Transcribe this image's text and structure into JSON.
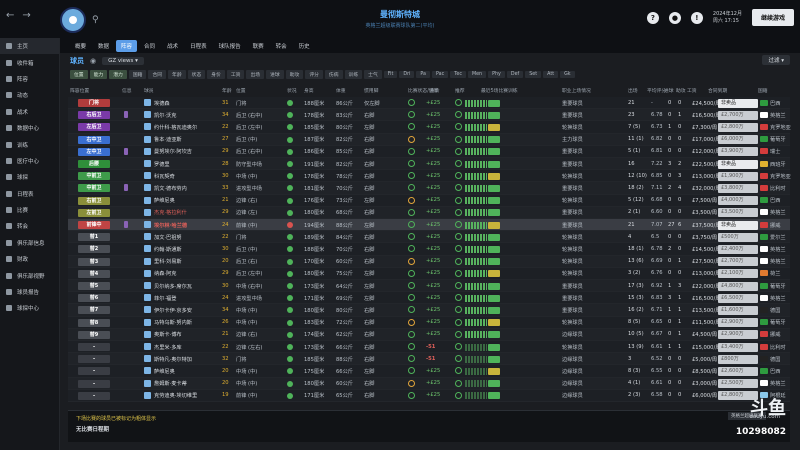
{
  "header": {
    "title": "曼彻斯特城",
    "subtitle": "英格兰超级联赛球队第二(平均)",
    "date_line1": "2024年12月",
    "date_line2": "周六 17:15",
    "continue_label": "继续游戏",
    "help_icon": "?"
  },
  "sidebar": {
    "items": [
      {
        "label": "主页",
        "icon": "home-icon"
      },
      {
        "label": "收件箱",
        "icon": "inbox-icon"
      },
      {
        "label": "阵容",
        "icon": "squad-icon"
      },
      {
        "label": "动态",
        "icon": "dynamics-icon"
      },
      {
        "label": "战术",
        "icon": "tactics-icon"
      },
      {
        "label": "数据中心",
        "icon": "data-icon"
      },
      {
        "label": "训练",
        "icon": "training-icon"
      },
      {
        "label": "医疗中心",
        "icon": "medical-icon"
      },
      {
        "label": "球探",
        "icon": "scouting-icon"
      },
      {
        "label": "日程表",
        "icon": "schedule-icon"
      },
      {
        "label": "比赛",
        "icon": "match-icon"
      },
      {
        "label": "转会",
        "icon": "transfers-icon"
      },
      {
        "label": "俱乐部信息",
        "icon": "club-info-icon"
      },
      {
        "label": "财政",
        "icon": "finance-icon"
      },
      {
        "label": "俱乐部视野",
        "icon": "vision-icon"
      },
      {
        "label": "球员报告",
        "icon": "report-icon"
      },
      {
        "label": "球探中心",
        "icon": "scout-center-icon"
      }
    ]
  },
  "nav": {
    "tabs": [
      "概要",
      "数据",
      "阵容",
      "合同",
      "战术",
      "日程表",
      "球队报告",
      "联赛",
      "转会",
      "历史"
    ],
    "active_index": 2
  },
  "filters": {
    "page_title": "球员",
    "views_label": "GZ views",
    "filter_label": "过滤"
  },
  "chips": [
    "位置",
    "能力",
    "潜力",
    "国籍",
    "合同",
    "年龄",
    "状态",
    "身价",
    "工资",
    "出场",
    "进球",
    "助攻",
    "评分",
    "伤病",
    "训练",
    "士气",
    "Fit",
    "Dri",
    "Pa",
    "Pac",
    "Tec",
    "Men",
    "Phy",
    "Def",
    "Set",
    "Att",
    "Gk"
  ],
  "table": {
    "columns": [
      "阵容位置",
      "信息",
      "球员",
      "年龄",
      "位置",
      "状况",
      "身高",
      "体重",
      "惯用脚",
      "比赛状态/健康",
      "身价",
      "推荐",
      "最近5场比赛",
      "训练",
      "职业上场情况",
      "出场",
      "平均评分",
      "进球",
      "助攻",
      "工资",
      "合同到期",
      "国籍"
    ],
    "rows": [
      {
        "pos": "门将",
        "pc": "#b13c3c",
        "name": "埃德森",
        "age": "31",
        "role": "门将",
        "h": "188厘米",
        "w": "86公斤",
        "foot": "仅左脚",
        "val": "+£25",
        "form": "重要球员",
        "apps": "21",
        "rat": "-",
        "g": "0",
        "a": "0",
        "wage": "£24,500/周",
        "contract": "非卖品",
        "nat": "巴西",
        "fc": "#2e9b3f"
      },
      {
        "pos": "右后卫",
        "pc": "#7a3aa8",
        "name": "凯尔·沃克",
        "age": "34",
        "role": "后卫 (右中)",
        "h": "178厘米",
        "w": "83公斤",
        "foot": "右脚",
        "val": "+£25",
        "form": "重要球员",
        "apps": "23",
        "rat": "6.78",
        "g": "0",
        "a": "1",
        "wage": "£16,500/周",
        "contract": "£2,700万",
        "nat": "英格兰",
        "fc": "#ffffff"
      },
      {
        "pos": "左后卫",
        "pc": "#7a3aa8",
        "name": "约什科·格瓦迪奥尔",
        "age": "22",
        "role": "后卫 (左中)",
        "h": "185厘米",
        "w": "80公斤",
        "foot": "左脚",
        "val": "+£25",
        "form": "轮换球员",
        "apps": "7 (5)",
        "rat": "6.73",
        "g": "1",
        "a": "0",
        "wage": "£7,300/周",
        "contract": "£2,800万",
        "nat": "克罗地亚",
        "fc": "#d43c3c"
      },
      {
        "pos": "右中卫",
        "pc": "#3a6fd0",
        "name": "鲁本·迪亚斯",
        "age": "27",
        "role": "后卫 (中)",
        "h": "187厘米",
        "w": "82公斤",
        "foot": "右脚",
        "val": "+£25",
        "form": "主力球员",
        "apps": "11 (1)",
        "rat": "6.82",
        "g": "0",
        "a": "0",
        "wage": "£17,000/周",
        "contract": "£6,000万",
        "nat": "葡萄牙",
        "fc": "#2e9b3f"
      },
      {
        "pos": "左中卫",
        "pc": "#3a6fd0",
        "name": "曼努埃尔·阿坎吉",
        "age": "29",
        "role": "后卫 (右中)",
        "h": "186厘米",
        "w": "85公斤",
        "foot": "右脚",
        "val": "+£25",
        "form": "重要球员",
        "apps": "5 (1)",
        "rat": "6.81",
        "g": "0",
        "a": "0",
        "wage": "£12,000/周",
        "contract": "£3,900万",
        "nat": "瑞士",
        "fc": "#d43c3c"
      },
      {
        "pos": "后腰",
        "pc": "#2f8f3a",
        "name": "罗德里",
        "age": "28",
        "role": "防守型中场",
        "h": "191厘米",
        "w": "82公斤",
        "foot": "右脚",
        "val": "+£25",
        "form": "重要球员",
        "apps": "16",
        "rat": "7.22",
        "g": "3",
        "a": "2",
        "wage": "£22,500/周",
        "contract": "非卖品",
        "nat": "西班牙",
        "fc": "#e0b030"
      },
      {
        "pos": "中前卫",
        "pc": "#3e9b4a",
        "name": "科瓦契奇",
        "age": "30",
        "role": "中场 (中)",
        "h": "178厘米",
        "w": "78公斤",
        "foot": "右脚",
        "val": "+£25",
        "form": "轮换球员",
        "apps": "12 (10)",
        "rat": "6.85",
        "g": "0",
        "a": "3",
        "wage": "£13,000/周",
        "contract": "£1,900万",
        "nat": "克罗地亚",
        "fc": "#d43c3c"
      },
      {
        "pos": "中前卫",
        "pc": "#3e9b4a",
        "name": "凯文·德布劳内",
        "age": "33",
        "role": "进攻型中场",
        "h": "181厘米",
        "w": "70公斤",
        "foot": "右脚",
        "val": "+£25",
        "form": "重要球员",
        "apps": "18 (2)",
        "rat": "7.11",
        "g": "2",
        "a": "4",
        "wage": "£32,000/周",
        "contract": "£3,800万",
        "nat": "比利时",
        "fc": "#d43c3c"
      },
      {
        "pos": "右前卫",
        "pc": "#8a8f3a",
        "name": "萨维尼奥",
        "age": "21",
        "role": "边锋 (右)",
        "h": "176厘米",
        "w": "73公斤",
        "foot": "左脚",
        "val": "+£25",
        "form": "轮换球员",
        "apps": "5 (12)",
        "rat": "6.68",
        "g": "0",
        "a": "0",
        "wage": "£7,500/周",
        "contract": "£4,000万",
        "nat": "巴西",
        "fc": "#2e9b3f"
      },
      {
        "pos": "左前卫",
        "pc": "#8a8f3a",
        "name": "杰克·格拉利什",
        "age": "29",
        "role": "边锋 (左)",
        "h": "180厘米",
        "w": "68公斤",
        "foot": "右脚",
        "val": "+£25",
        "form": "重要球员",
        "apps": "2 (1)",
        "rat": "6.60",
        "g": "0",
        "a": "0",
        "wage": "£3,500/周",
        "contract": "£3,500万",
        "nat": "英格兰",
        "fc": "#ffffff"
      },
      {
        "pos": "前锋中",
        "pc": "#c04444",
        "name": "埃尔林·哈兰德",
        "age": "24",
        "role": "前锋 (中)",
        "h": "194厘米",
        "w": "88公斤",
        "foot": "左脚",
        "val": "+£25",
        "form": "重要球员",
        "apps": "21",
        "rat": "7.07",
        "g": "27",
        "a": "6",
        "wage": "£37,500/周",
        "contract": "非卖品",
        "nat": "挪威",
        "fc": "#d43c3c"
      },
      {
        "pos": "替1",
        "pc": "#4a4e55",
        "name": "加文·巴祖努",
        "age": "22",
        "role": "门将",
        "h": "189厘米",
        "w": "84公斤",
        "foot": "右脚",
        "val": "+£25",
        "form": "轮换球员",
        "apps": "4",
        "rat": "6.5",
        "g": "0",
        "a": "0",
        "wage": "£3,750/周",
        "contract": "£500万",
        "nat": "爱尔兰",
        "fc": "#2e9b3f"
      },
      {
        "pos": "替2",
        "pc": "#4a4e55",
        "name": "约翰·斯通斯",
        "age": "30",
        "role": "后卫 (中)",
        "h": "188厘米",
        "w": "70公斤",
        "foot": "右脚",
        "val": "+£25",
        "form": "轮换球员",
        "apps": "18 (1)",
        "rat": "6.78",
        "g": "2",
        "a": "0",
        "wage": "£14,500/周",
        "contract": "£2,400万",
        "nat": "英格兰",
        "fc": "#ffffff"
      },
      {
        "pos": "替3",
        "pc": "#4a4e55",
        "name": "里科·刘易斯",
        "age": "20",
        "role": "后卫 (右)",
        "h": "170厘米",
        "w": "60公斤",
        "foot": "右脚",
        "val": "+£25",
        "form": "轮换球员",
        "apps": "13 (6)",
        "rat": "6.69",
        "g": "0",
        "a": "1",
        "wage": "£27,500/周",
        "contract": "£2,700万",
        "nat": "英格兰",
        "fc": "#ffffff"
      },
      {
        "pos": "替4",
        "pc": "#4a4e55",
        "name": "纳森·阿克",
        "age": "29",
        "role": "后卫 (左中)",
        "h": "180厘米",
        "w": "75公斤",
        "foot": "左脚",
        "val": "+£25",
        "form": "轮换球员",
        "apps": "3 (2)",
        "rat": "6.76",
        "g": "0",
        "a": "0",
        "wage": "£13,000/周",
        "contract": "£2,100万",
        "nat": "荷兰",
        "fc": "#e07a30"
      },
      {
        "pos": "替5",
        "pc": "#4a4e55",
        "name": "贝尔纳多·席尔瓦",
        "age": "30",
        "role": "中场 (右中)",
        "h": "173厘米",
        "w": "64公斤",
        "foot": "左脚",
        "val": "+£25",
        "form": "重要球员",
        "apps": "17 (3)",
        "rat": "6.92",
        "g": "1",
        "a": "3",
        "wage": "£22,000/周",
        "contract": "£4,800万",
        "nat": "葡萄牙",
        "fc": "#2e9b3f"
      },
      {
        "pos": "替6",
        "pc": "#4a4e55",
        "name": "菲尔·福登",
        "age": "24",
        "role": "进攻型中场",
        "h": "171厘米",
        "w": "69公斤",
        "foot": "左脚",
        "val": "+£25",
        "form": "重要球员",
        "apps": "15 (3)",
        "rat": "6.83",
        "g": "3",
        "a": "1",
        "wage": "£16,500/周",
        "contract": "£6,500万",
        "nat": "英格兰",
        "fc": "#ffffff"
      },
      {
        "pos": "替7",
        "pc": "#4a4e55",
        "name": "伊尔卡伊·京多安",
        "age": "34",
        "role": "中场 (中)",
        "h": "180厘米",
        "w": "80公斤",
        "foot": "右脚",
        "val": "+£25",
        "form": "重要球员",
        "apps": "16 (2)",
        "rat": "6.71",
        "g": "1",
        "a": "1",
        "wage": "£13,500/周",
        "contract": "£1,600万",
        "nat": "德国",
        "fc": "#222222"
      },
      {
        "pos": "替8",
        "pc": "#4a4e55",
        "name": "马特乌斯·努内斯",
        "age": "26",
        "role": "中场 (中)",
        "h": "183厘米",
        "w": "72公斤",
        "foot": "右脚",
        "val": "+£25",
        "form": "轮换球员",
        "apps": "8 (5)",
        "rat": "6.65",
        "g": "0",
        "a": "1",
        "wage": "£11,500/周",
        "contract": "£2,900万",
        "nat": "葡萄牙",
        "fc": "#2e9b3f"
      },
      {
        "pos": "替9",
        "pc": "#4a4e55",
        "name": "奥斯卡·博布",
        "age": "21",
        "role": "边锋 (右)",
        "h": "174厘米",
        "w": "62公斤",
        "foot": "右脚",
        "val": "+£25",
        "form": "边缘球员",
        "apps": "10 (5)",
        "rat": "6.67",
        "g": "0",
        "a": "1",
        "wage": "£4,500/周",
        "contract": "£2,900万",
        "nat": "挪威",
        "fc": "#d43c3c"
      },
      {
        "pos": "-",
        "pc": "#3a3d44",
        "name": "杰里米·多库",
        "age": "22",
        "role": "边锋 (左右)",
        "h": "173厘米",
        "w": "66公斤",
        "foot": "右脚",
        "val": "-51",
        "form": "轮换球员",
        "apps": "13 (9)",
        "rat": "6.61",
        "g": "1",
        "a": "1",
        "wage": "£15,000/周",
        "contract": "£3,400万",
        "nat": "比利时",
        "fc": "#d43c3c"
      },
      {
        "pos": "-",
        "pc": "#3a3d44",
        "name": "斯特凡·奥尔特加",
        "age": "32",
        "role": "门将",
        "h": "185厘米",
        "w": "88公斤",
        "foot": "右脚",
        "val": "-51",
        "form": "边缘球员",
        "apps": "3",
        "rat": "6.52",
        "g": "0",
        "a": "0",
        "wage": "£5,000/周",
        "contract": "£800万",
        "nat": "德国",
        "fc": "#222222"
      },
      {
        "pos": "-",
        "pc": "#3a3d44",
        "name": "萨维尼奥",
        "age": "20",
        "role": "中场 (中)",
        "h": "175厘米",
        "w": "66公斤",
        "foot": "左脚",
        "val": "+£25",
        "form": "边缘球员",
        "apps": "8 (3)",
        "rat": "6.55",
        "g": "0",
        "a": "0",
        "wage": "£8,500/周",
        "contract": "£2,600万",
        "nat": "巴西",
        "fc": "#2e9b3f"
      },
      {
        "pos": "-",
        "pc": "#3a3d44",
        "name": "詹姆斯·麦卡蒂",
        "age": "20",
        "role": "中场 (中)",
        "h": "180厘米",
        "w": "60公斤",
        "foot": "右脚",
        "val": "+£25",
        "form": "边缘球员",
        "apps": "4 (1)",
        "rat": "6.61",
        "g": "0",
        "a": "0",
        "wage": "£3,000/周",
        "contract": "£2,500万",
        "nat": "英格兰",
        "fc": "#ffffff"
      },
      {
        "pos": "-",
        "pc": "#3a3d44",
        "name": "克劳迪奥·埃切维里",
        "age": "19",
        "role": "前锋 (中)",
        "h": "171厘米",
        "w": "65公斤",
        "foot": "右脚",
        "val": "+£25",
        "form": "边缘球员",
        "apps": "2 (3)",
        "rat": "6.58",
        "g": "0",
        "a": "0",
        "wage": "£6,000/周",
        "contract": "£2,800万",
        "nat": "阿根廷",
        "fc": "#8ac7ea"
      }
    ]
  },
  "bottom": {
    "tip1": "下场比赛的球员已被标记为粗体显示",
    "tip2": "无比赛日程期",
    "corner": "英格兰超级联赛",
    "logo": "斗鱼",
    "logo_sub": "douyu.com",
    "room_id": "10298082"
  }
}
